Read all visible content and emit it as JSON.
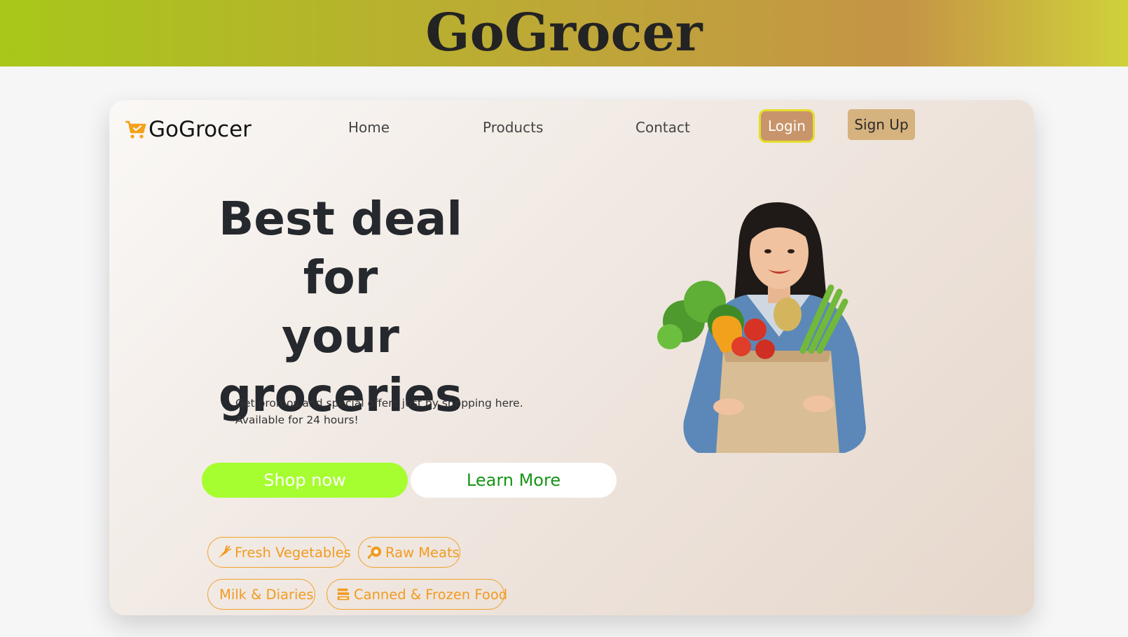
{
  "banner": {
    "title": "GoGrocer"
  },
  "nav": {
    "logo_text": "GoGrocer",
    "logo_icon": "shopping-cart-icon",
    "links": [
      "Home",
      "Products",
      "Contact"
    ],
    "login_label": "Login",
    "signup_label": "Sign Up"
  },
  "hero": {
    "title_lines": [
      "Best deal for",
      "your",
      "groceries"
    ],
    "subtitle_lines": [
      "Get promos and special offers just by shopping here.",
      "Available for 24 hours!"
    ],
    "shop_label": "Shop now",
    "learn_label": "Learn More",
    "image_alt": "woman holding a paper bag of fresh vegetables"
  },
  "categories": [
    {
      "label": "Fresh Vegetables",
      "icon": "carrot-icon"
    },
    {
      "label": "Raw Meats",
      "icon": "drumstick-icon"
    },
    {
      "label": "Milk & Diaries",
      "icon": ""
    },
    {
      "label": "Canned & Frozen Food",
      "icon": "canned-food-icon"
    }
  ],
  "colors": {
    "shop_button": "#a6fd30",
    "learn_text": "#179517",
    "pill_accent": "#f19b21",
    "login_bg": "#c8956a",
    "login_border": "#e5de2c",
    "signup_bg": "#d6b27e"
  }
}
